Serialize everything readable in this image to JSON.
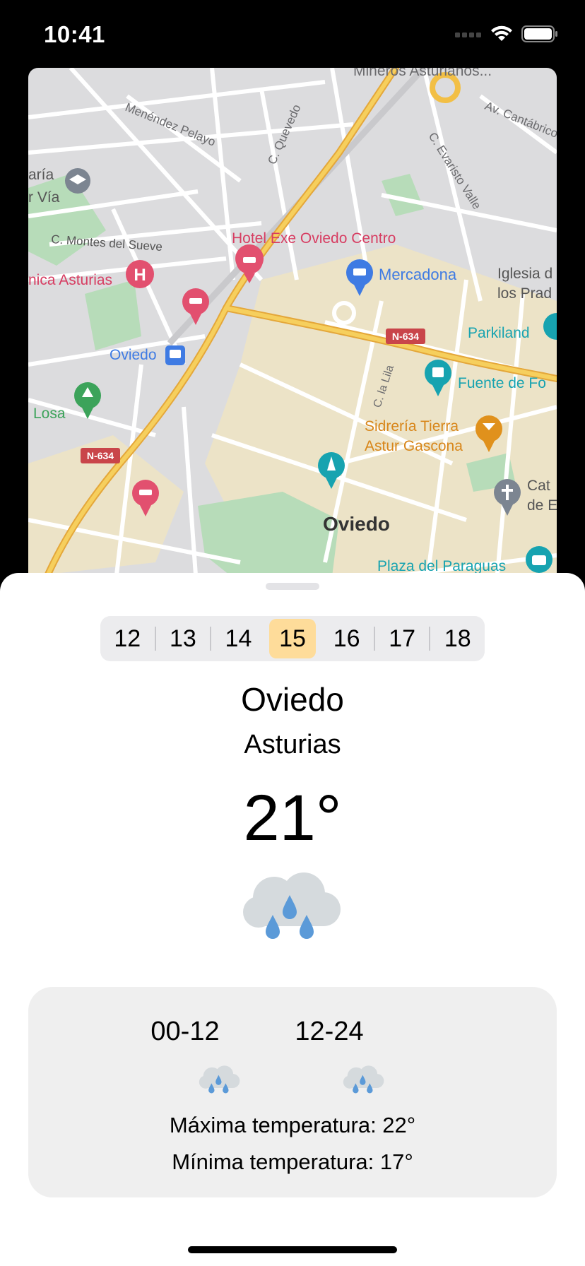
{
  "status_bar": {
    "time": "10:41",
    "icons": [
      "cellular-icon",
      "wifi-icon",
      "battery-icon"
    ]
  },
  "map": {
    "labels": {
      "mineros": "Mineros Asturianos...",
      "av_cantabrico": "Av. Cantábrico",
      "menendez_pelayo": "Menéndez Pelayo",
      "quevedo": "C. Quevedo",
      "evaristo_valle": "C. Evaristo Valle",
      "maria": "aría",
      "via": "r Vía",
      "montes_sueve": "C. Montes del Sueve",
      "hotel_exe": "Hotel Exe Oviedo Centro",
      "mercadona": "Mercadona",
      "iglesia_1": "Iglesia d",
      "iglesia_2": "los Prad",
      "clinica": "nica Asturias",
      "n634_right": "N-634",
      "parkiland": "Parkiland",
      "oviedo_station": "Oviedo",
      "c_la_lila": "C. la Lila",
      "fuente": "Fuente de Fo",
      "losa": "Losa",
      "sidreria_1": "Sidrería Tierra",
      "sidreria_2": "Astur Gascona",
      "n634_left": "N-634",
      "cat_1": "Cat",
      "cat_2": "de E",
      "oviedo_city": "Oviedo",
      "plaza": "Plaza del Paraguas"
    },
    "colors": {
      "background": "#dcdcde",
      "highway": "#f2bf45",
      "park": "#b7dcb9",
      "urban": "#ece3c7",
      "hotel_pin": "#e2506f",
      "shop_pin": "#3f7be3",
      "park_pin": "#3ca35a",
      "food_pin": "#e0911c",
      "teal_pin": "#17a3b0",
      "gray_pin": "#7c8591"
    }
  },
  "days": {
    "items": [
      "12",
      "13",
      "14",
      "15",
      "16",
      "17",
      "18"
    ],
    "selected": "15",
    "selected_color": "#fedc9a"
  },
  "location": {
    "city": "Oviedo",
    "region": "Asturias"
  },
  "current": {
    "temperature": "21°",
    "icon": "rain-cloud-icon"
  },
  "forecast": {
    "periods": [
      {
        "label": "00-12",
        "icon": "rain-cloud-icon"
      },
      {
        "label": "12-24",
        "icon": "rain-cloud-icon"
      }
    ],
    "max_temp": "Máxima temperatura: 22°",
    "min_temp": "Mínima temperatura: 17°"
  }
}
